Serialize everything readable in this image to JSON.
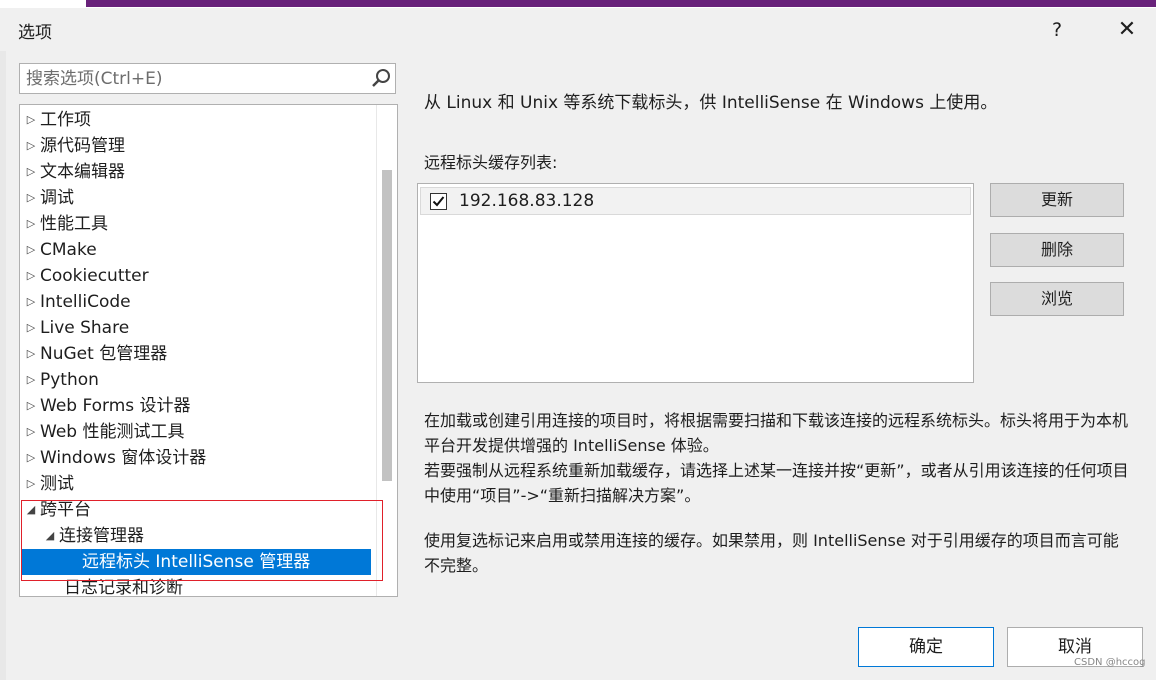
{
  "window": {
    "title": "选项",
    "help_label": "?",
    "close_label": "✕"
  },
  "search": {
    "placeholder": "搜索选项(Ctrl+E)"
  },
  "tree": {
    "items": [
      {
        "label": "工作项",
        "expander": "▷"
      },
      {
        "label": "源代码管理",
        "expander": "▷"
      },
      {
        "label": "文本编辑器",
        "expander": "▷"
      },
      {
        "label": "调试",
        "expander": "▷"
      },
      {
        "label": "性能工具",
        "expander": "▷"
      },
      {
        "label": "CMake",
        "expander": "▷"
      },
      {
        "label": "Cookiecutter",
        "expander": "▷"
      },
      {
        "label": "IntelliCode",
        "expander": "▷"
      },
      {
        "label": "Live Share",
        "expander": "▷"
      },
      {
        "label": "NuGet 包管理器",
        "expander": "▷"
      },
      {
        "label": "Python",
        "expander": "▷"
      },
      {
        "label": "Web Forms 设计器",
        "expander": "▷"
      },
      {
        "label": "Web 性能测试工具",
        "expander": "▷"
      },
      {
        "label": "Windows 窗体设计器",
        "expander": "▷"
      },
      {
        "label": "测试",
        "expander": "▷"
      },
      {
        "label": "跨平台",
        "expander": "◢"
      },
      {
        "label": "连接管理器",
        "expander": "◢"
      },
      {
        "label": "远程标头 IntelliSense 管理器",
        "expander": ""
      },
      {
        "label": "日志记录和诊断",
        "expander": ""
      }
    ]
  },
  "main": {
    "description": "从 Linux 和 Unix 等系统下载标头，供 IntelliSense 在 Windows 上使用。",
    "cache_label": "远程标头缓存列表:",
    "cache_items": [
      {
        "host": "192.168.83.128",
        "checked": true
      }
    ],
    "buttons": {
      "update": "更新",
      "delete": "删除",
      "browse": "浏览"
    },
    "info1": "在加载或创建引用连接的项目时，将根据需要扫描和下载该连接的远程系统标头。标头将用于为本机平台开发提供增强的 IntelliSense 体验。",
    "info2": "若要强制从远程系统重新加载缓存，请选择上述某一连接并按“更新”，或者从引用该连接的任何项目中使用“项目”->“重新扫描解决方案”。",
    "info3": "使用复选标记来启用或禁用连接的缓存。如果禁用，则 IntelliSense 对于引用缓存的项目而言可能不完整。"
  },
  "footer": {
    "ok": "确定",
    "cancel": "取消"
  },
  "watermark": "CSDN @hccog",
  "colors": {
    "selection": "#0078d7",
    "highlight_box": "#e0202a",
    "title_accent": "#68217a"
  }
}
